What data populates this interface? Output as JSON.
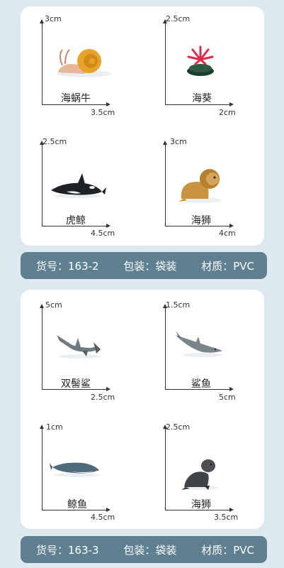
{
  "set1": {
    "items": [
      {
        "name": "海蜗牛",
        "height": "3cm",
        "width": "3.5cm",
        "icon": "sea-snail-icon"
      },
      {
        "name": "海葵",
        "height": "2.5cm",
        "width": "2cm",
        "icon": "sea-anemone-icon"
      },
      {
        "name": "虎鲸",
        "height": "2.5cm",
        "width": "4.5cm",
        "icon": "orca-icon"
      },
      {
        "name": "海狮",
        "height": "3cm",
        "width": "4cm",
        "icon": "sea-lion-icon"
      }
    ],
    "info": {
      "sku": "货号：163-2",
      "pack": "包装：袋装",
      "material": "材质：PVC"
    }
  },
  "set2": {
    "items": [
      {
        "name": "双髻鲨",
        "height": "5cm",
        "width": "2.5cm",
        "icon": "hammerhead-shark-icon"
      },
      {
        "name": "鲨鱼",
        "height": "1.5cm",
        "width": "5cm",
        "icon": "shark-icon"
      },
      {
        "name": "鲸鱼",
        "height": "1cm",
        "width": "4.5cm",
        "icon": "whale-icon"
      },
      {
        "name": "海狮",
        "height": "2.5cm",
        "width": "3.5cm",
        "icon": "sea-lion-icon"
      }
    ],
    "info": {
      "sku": "货号：163-3",
      "pack": "包装：袋装",
      "material": "材质：PVC"
    }
  }
}
